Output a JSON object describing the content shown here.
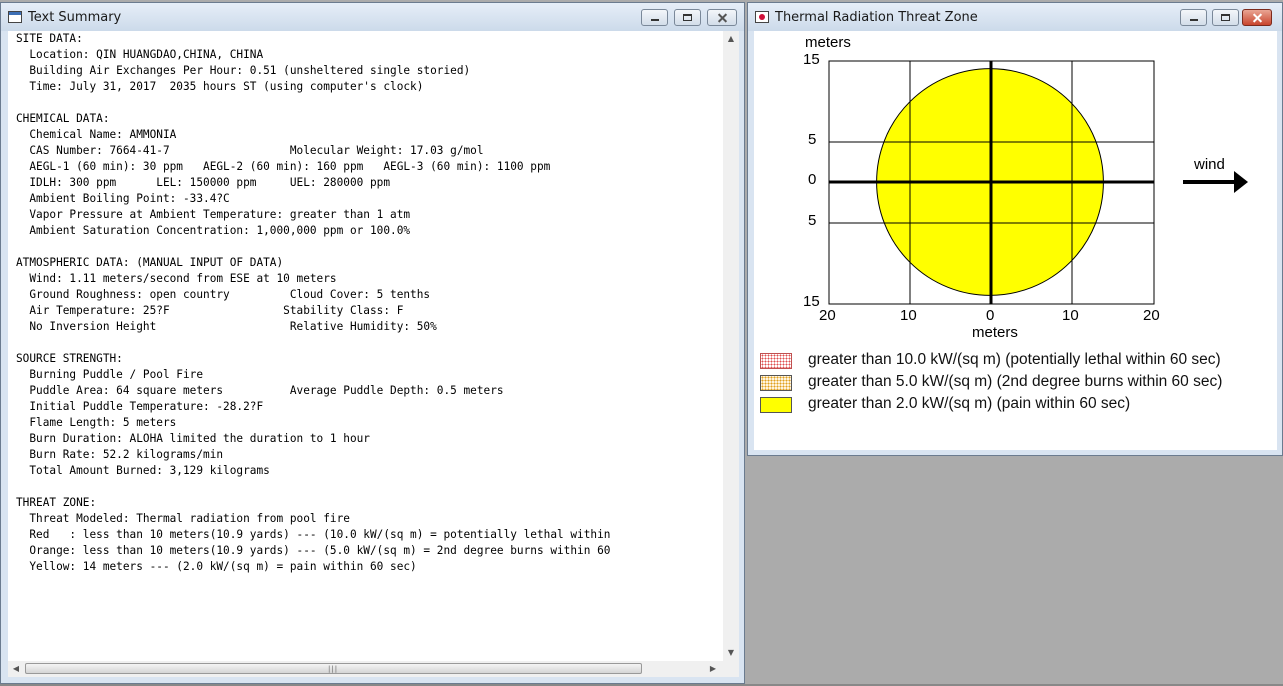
{
  "text_window": {
    "title": "Text Summary",
    "summary_lines": [
      "SITE DATA:",
      "  Location: QIN HUANGDAO,CHINA, CHINA",
      "  Building Air Exchanges Per Hour: 0.51 (unsheltered single storied)",
      "  Time: July 31, 2017  2035 hours ST (using computer's clock)",
      "",
      "CHEMICAL DATA:",
      "  Chemical Name: AMMONIA",
      "  CAS Number: 7664-41-7                  Molecular Weight: 17.03 g/mol",
      "  AEGL-1 (60 min): 30 ppm   AEGL-2 (60 min): 160 ppm   AEGL-3 (60 min): 1100 ppm",
      "  IDLH: 300 ppm      LEL: 150000 ppm     UEL: 280000 ppm",
      "  Ambient Boiling Point: -33.4?C",
      "  Vapor Pressure at Ambient Temperature: greater than 1 atm",
      "  Ambient Saturation Concentration: 1,000,000 ppm or 100.0%",
      "",
      "ATMOSPHERIC DATA: (MANUAL INPUT OF DATA)",
      "  Wind: 1.11 meters/second from ESE at 10 meters",
      "  Ground Roughness: open country         Cloud Cover: 5 tenths",
      "  Air Temperature: 25?F                 Stability Class: F",
      "  No Inversion Height                    Relative Humidity: 50%",
      "",
      "SOURCE STRENGTH:",
      "  Burning Puddle / Pool Fire",
      "  Puddle Area: 64 square meters          Average Puddle Depth: 0.5 meters",
      "  Initial Puddle Temperature: -28.2?F",
      "  Flame Length: 5 meters",
      "  Burn Duration: ALOHA limited the duration to 1 hour",
      "  Burn Rate: 52.2 kilograms/min",
      "  Total Amount Burned: 3,129 kilograms",
      "",
      "THREAT ZONE:",
      "  Threat Modeled: Thermal radiation from pool fire",
      "  Red   : less than 10 meters(10.9 yards) --- (10.0 kW/(sq m) = potentially lethal within",
      "  Orange: less than 10 meters(10.9 yards) --- (5.0 kW/(sq m) = 2nd degree burns within 60",
      "  Yellow: 14 meters --- (2.0 kW/(sq m) = pain within 60 sec)"
    ]
  },
  "threat_window": {
    "title": "Thermal Radiation Threat Zone",
    "y_axis_title": "meters",
    "x_axis_title": "meters",
    "y_ticks": [
      "15",
      "5",
      "0",
      "5",
      "15"
    ],
    "x_ticks": [
      "20",
      "10",
      "0",
      "10",
      "20"
    ],
    "wind_label": "wind",
    "yellow_radius_m": 14,
    "legend": [
      {
        "swatch": "red-dotted",
        "text": "greater than 10.0 kW/(sq m) (potentially lethal within 60 sec)"
      },
      {
        "swatch": "orange-dotted",
        "text": "greater than 5.0 kW/(sq m) (2nd degree burns within 60 sec)"
      },
      {
        "swatch": "yellow",
        "text": "greater than 2.0 kW/(sq m) (pain within 60 sec)"
      }
    ],
    "colors": {
      "yellow_zone": "#ffff00",
      "orange_zone": "#ffa500",
      "red_zone": "#ff0000"
    }
  }
}
